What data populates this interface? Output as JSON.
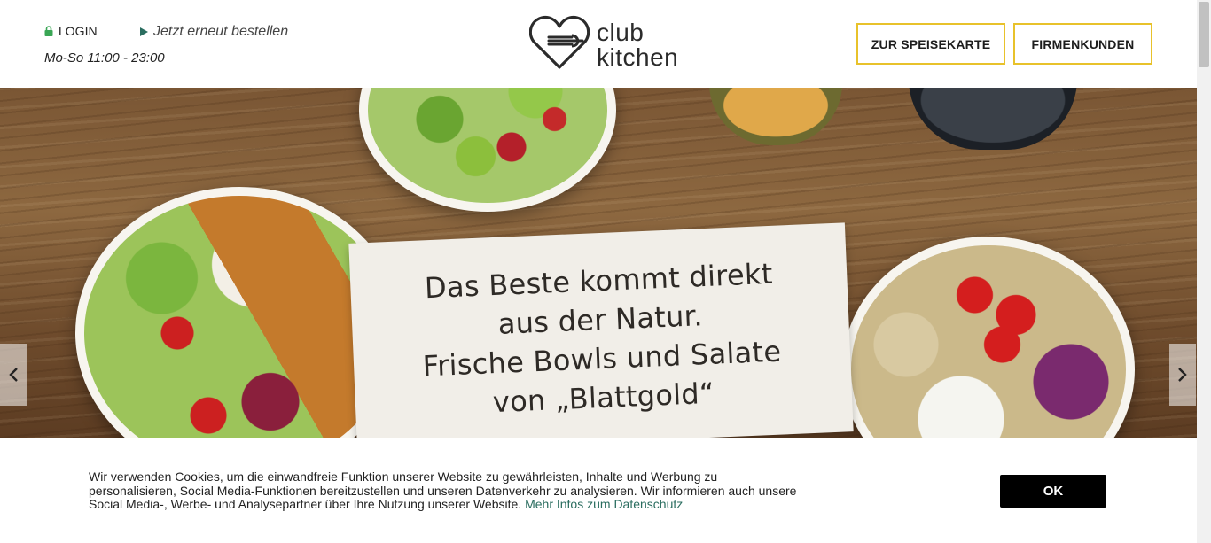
{
  "header": {
    "login_label": "LOGIN",
    "reorder_label": "Jetzt erneut bestellen",
    "hours": "Mo-So 11:00 - 23:00",
    "logo_line1": "club",
    "logo_line2": "kitchen",
    "menu_button": "ZUR SPEISEKARTE",
    "business_button": "FIRMENKUNDEN"
  },
  "hero": {
    "lines": [
      "Das Beste kommt direkt",
      "aus der Natur.",
      "Frische Bowls und Salate",
      "von „Blattgold“"
    ]
  },
  "cookie": {
    "text": "Wir verwenden Cookies, um die einwandfreie Funktion unserer Website zu gewährleisten, Inhalte und Werbung zu personalisieren, Social Media-Funktionen bereitzustellen und unseren Datenverkehr zu analysieren. Wir informieren auch unsere Social Media-, Werbe- und Analysepartner über Ihre Nutzung unserer Website.",
    "link": "Mehr Infos zum Datenschutz",
    "ok_button": "OK"
  },
  "colors": {
    "accent_yellow": "#e8c22b",
    "accent_green": "#2a6d5f",
    "lock_green": "#3aa655"
  },
  "icons": [
    "lock-icon",
    "play-icon",
    "heart-fork-logo-icon",
    "chevron-left-icon",
    "chevron-right-icon"
  ]
}
